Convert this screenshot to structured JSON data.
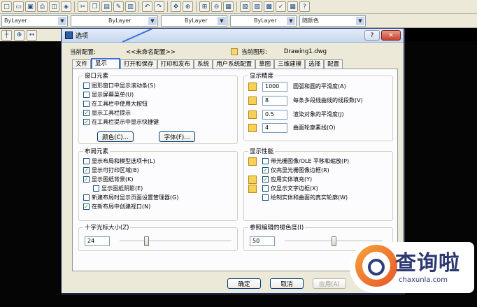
{
  "cad": {
    "toolbar_icons": [
      "new-icon",
      "open-icon",
      "save-icon",
      "print-icon",
      "plot-preview-icon",
      "publish-icon",
      "cut-icon",
      "copy-icon",
      "paste-icon",
      "match-properties-icon",
      "block-editor-icon",
      "undo-icon",
      "redo-icon",
      "pan-icon",
      "zoom-realtime-icon",
      "zoom-window-icon",
      "zoom-previous-icon",
      "properties-icon",
      "design-center-icon",
      "tool-palettes-icon",
      "sheet-set-icon",
      "markup-icon",
      "calculator-icon",
      "help-icon"
    ],
    "propbar": {
      "layer": "ByLayer",
      "color": "ByLayer",
      "linetype": "ByLayer",
      "lineweight": "ByLayer",
      "plotstyle": "随颜色"
    }
  },
  "dialog": {
    "title": "选项",
    "help_label": "?",
    "close_label": "✕",
    "current_profile_label": "当前配置:",
    "current_profile_value": "<<未命名配置>>",
    "current_drawing_label": "当前图形:",
    "current_drawing_value": "Drawing1.dwg",
    "tabs": [
      "文件",
      "显示",
      "打开和保存",
      "打印和发布",
      "系统",
      "用户系统配置",
      "草图",
      "三维建模",
      "选择",
      "配置"
    ],
    "window_elements": {
      "title": "窗口元素",
      "items": [
        {
          "label": "图形窗口中显示滚动条(S)",
          "checked": false
        },
        {
          "label": "显示屏幕菜单(U)",
          "checked": false
        },
        {
          "label": "在工具栏中使用大按钮",
          "checked": false
        },
        {
          "label": "显示工具栏提示",
          "checked": true
        },
        {
          "label": "在工具栏提示中显示快捷键",
          "checked": true
        }
      ],
      "colors_button": "颜色(C)...",
      "fonts_button": "字体(F)..."
    },
    "layout_elements": {
      "title": "布局元素",
      "items": [
        {
          "label": "显示布局和模型选项卡(L)",
          "checked": false
        },
        {
          "label": "显示可打印区域(B)",
          "checked": true
        },
        {
          "label": "显示图纸背景(K)",
          "checked": true
        },
        {
          "label": "显示图纸阴影(E)",
          "checked": false
        },
        {
          "label": "新建布局时显示页面设置管理器(G)",
          "checked": false
        },
        {
          "label": "在新布局中创建视口(N)",
          "checked": true
        }
      ]
    },
    "display_resolution": {
      "title": "显示精度",
      "items": [
        {
          "value": "1000",
          "label": "圆弧和圆的平滑度(A)"
        },
        {
          "value": "8",
          "label": "每条多段线曲线的线段数(V)"
        },
        {
          "value": "0.5",
          "label": "渲染对象的平滑度(J)"
        },
        {
          "value": "4",
          "label": "曲面轮廓素线(O)"
        }
      ]
    },
    "display_performance": {
      "title": "显示性能",
      "items": [
        {
          "label": "带光栅图像/OLE 平移和缩放(P)",
          "checked": false
        },
        {
          "label": "仅亮显光栅图像边框(R)",
          "checked": true
        },
        {
          "label": "应用实体填充(Y)",
          "checked": true
        },
        {
          "label": "仅显示文字边框(X)",
          "checked": false
        },
        {
          "label": "绘制实体和曲面的真实轮廓(W)",
          "checked": false
        }
      ]
    },
    "crosshair": {
      "title": "十字光标大小(Z)",
      "value": "24",
      "level": 0.24
    },
    "fade": {
      "title": "参照编辑的褪色度(I)",
      "value": "50",
      "level": 0.5
    },
    "ok_button": "确定",
    "cancel_button": "取消",
    "apply_button": "应用(A)"
  },
  "watermark": {
    "text": "查询啦",
    "subtext": "chaxunla.com"
  }
}
